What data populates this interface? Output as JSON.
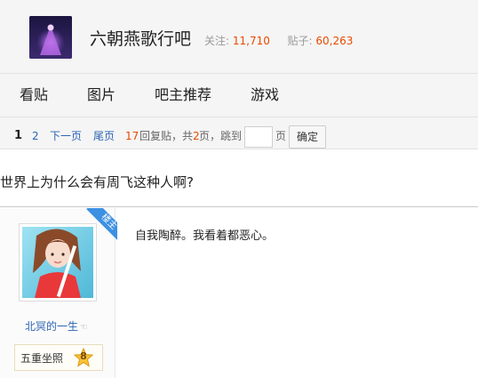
{
  "forum": {
    "name": "六朝燕歌行吧",
    "followers_label": "关注:",
    "followers": "11,710",
    "posts_label": "贴子:",
    "posts": "60,263"
  },
  "nav": {
    "items": [
      {
        "label": "看贴"
      },
      {
        "label": "图片"
      },
      {
        "label": "吧主推荐"
      },
      {
        "label": "游戏"
      }
    ]
  },
  "pager": {
    "current": "1",
    "page2": "2",
    "next": "下一页",
    "last": "尾页",
    "reply_count": "17",
    "reply_label": "回复贴，共",
    "total_pages": "2",
    "pages_label": "页，",
    "jump_label": "跳到",
    "jump_value": "",
    "page_unit": "页",
    "confirm": "确定"
  },
  "thread": {
    "title": "世界上为什么会有周飞这种人啊?"
  },
  "post": {
    "role_badge": "楼主",
    "author": "北冥的一生",
    "level_name": "五重坐照",
    "level_num": "8",
    "content": "自我陶醉。我看着都恶心。"
  },
  "colors": {
    "accent_link": "#2d64b3",
    "count_orange": "#e84a00",
    "badge_blue": "#3d90e2"
  }
}
